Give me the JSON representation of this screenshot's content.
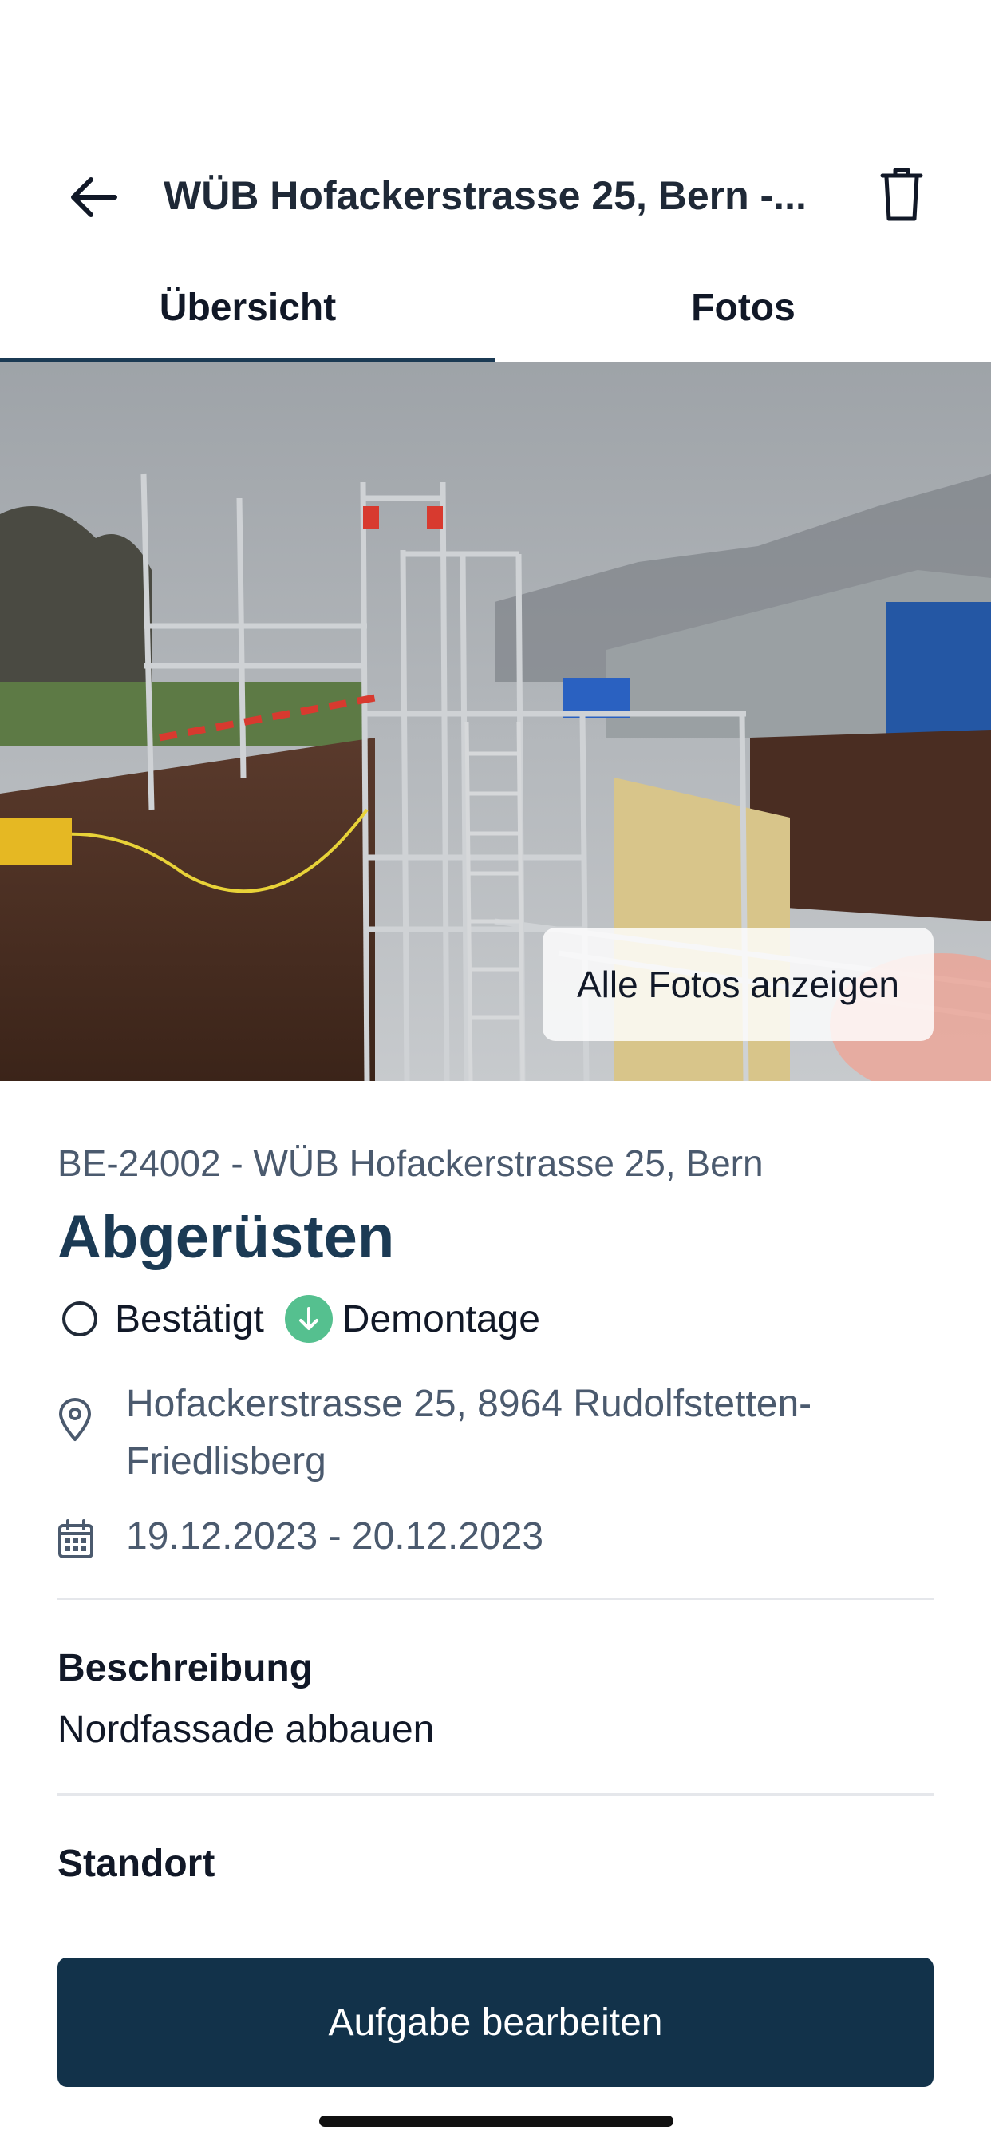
{
  "header": {
    "title": "WÜB Hofackerstrasse 25, Bern -...",
    "back_icon": "arrow-left-icon",
    "trash_icon": "trash-icon"
  },
  "tabs": [
    {
      "label": "Übersicht",
      "active": true
    },
    {
      "label": "Fotos",
      "active": false
    }
  ],
  "hero": {
    "show_all_label": "Alle Fotos anzeigen"
  },
  "task": {
    "project": "BE-24002 - WÜB Hofackerstrasse 25, Bern",
    "title": "Abgerüsten",
    "status": "Bestätigt",
    "type": "Demontage",
    "address": "Hofackerstrasse 25, 8964 Rudolfstetten-Friedlisberg",
    "date_range": "19.12.2023 - 20.12.2023"
  },
  "description": {
    "label": "Beschreibung",
    "text": "Nordfassade abbauen"
  },
  "location": {
    "label": "Standort"
  },
  "actions": {
    "edit_label": "Aufgabe bearbeiten"
  },
  "colors": {
    "primary": "#1b3a54",
    "button": "#12324a",
    "status_green": "#55c08f",
    "muted_text": "#4b5a6e"
  }
}
